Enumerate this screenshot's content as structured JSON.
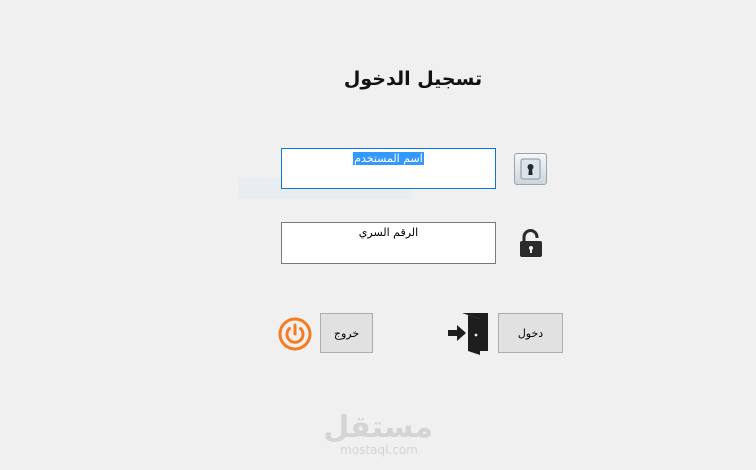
{
  "form": {
    "title": "تسجيل الدخول",
    "username": {
      "value": "اسم المستخدم",
      "selected": true
    },
    "password": {
      "value": "الرقم السري"
    }
  },
  "buttons": {
    "exit_label": "خروج",
    "login_label": "دخول"
  },
  "icons": {
    "keyhole": "keyhole-lock-icon",
    "padlock": "padlock-icon",
    "power": "power-icon",
    "door": "enter-door-icon"
  },
  "colors": {
    "background": "#f0f0f0",
    "focus_border": "#0a78d7",
    "selection": "#3399ff",
    "power_orange": "#f57c1f",
    "watermark": "#d4d4d4"
  },
  "watermark": {
    "brand": "مستقل",
    "url": "mostaql.com"
  }
}
